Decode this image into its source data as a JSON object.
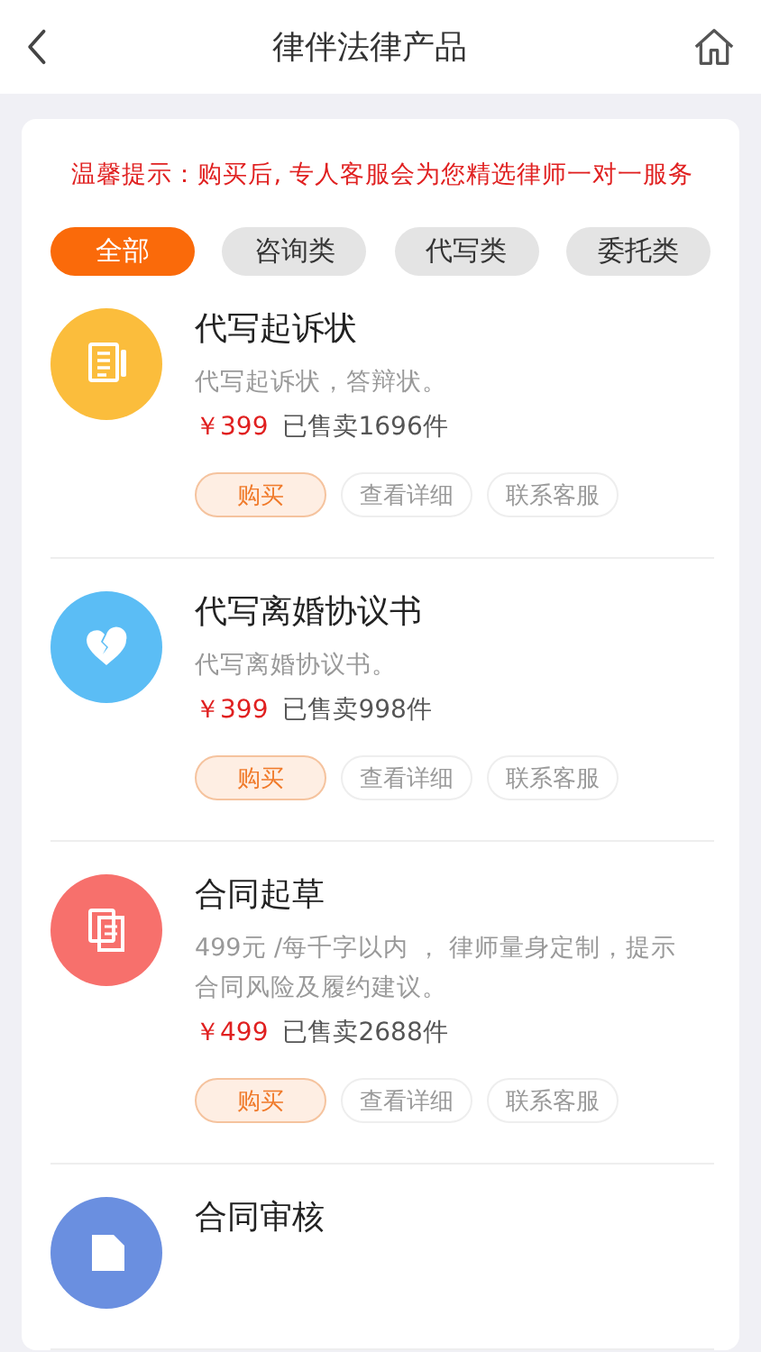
{
  "header": {
    "title": "律伴法律产品"
  },
  "notice": "温馨提示：购买后, 专人客服会为您精选律师一对一服务",
  "tabs": [
    {
      "label": "全部",
      "selected": true
    },
    {
      "label": "咨询类",
      "selected": false
    },
    {
      "label": "代写类",
      "selected": false
    },
    {
      "label": "委托类",
      "selected": false
    }
  ],
  "products": [
    {
      "title": "代写起诉状",
      "color": "#fbbd3c",
      "description": "代写起诉状，答辩状。",
      "price": "￥399",
      "sold": "已售卖1696件",
      "buttons": [
        {
          "label": "购买",
          "kind": "buy"
        },
        {
          "label": "查看详细",
          "kind": "plain"
        },
        {
          "label": "联系客服",
          "kind": "plain"
        }
      ]
    },
    {
      "title": "代写离婚协议书",
      "color": "#5bbdf5",
      "description": "代写离婚协议书。",
      "price": "￥399",
      "sold": "已售卖998件",
      "buttons": [
        {
          "label": "购买",
          "kind": "buy"
        },
        {
          "label": "查看详细",
          "kind": "plain"
        },
        {
          "label": "联系客服",
          "kind": "plain"
        }
      ]
    },
    {
      "title": "合同起草",
      "color": "#f7706c",
      "description": "499元 /每千字以内 ， 律师量身定制，提示合同风险及履约建议。",
      "price": "￥499",
      "sold": "已售卖2688件",
      "buttons": [
        {
          "label": "购买",
          "kind": "buy"
        },
        {
          "label": "查看详细",
          "kind": "plain"
        },
        {
          "label": "联系客服",
          "kind": "plain"
        }
      ]
    },
    {
      "title": "合同审核",
      "color": "#6a8fe0"
    }
  ]
}
